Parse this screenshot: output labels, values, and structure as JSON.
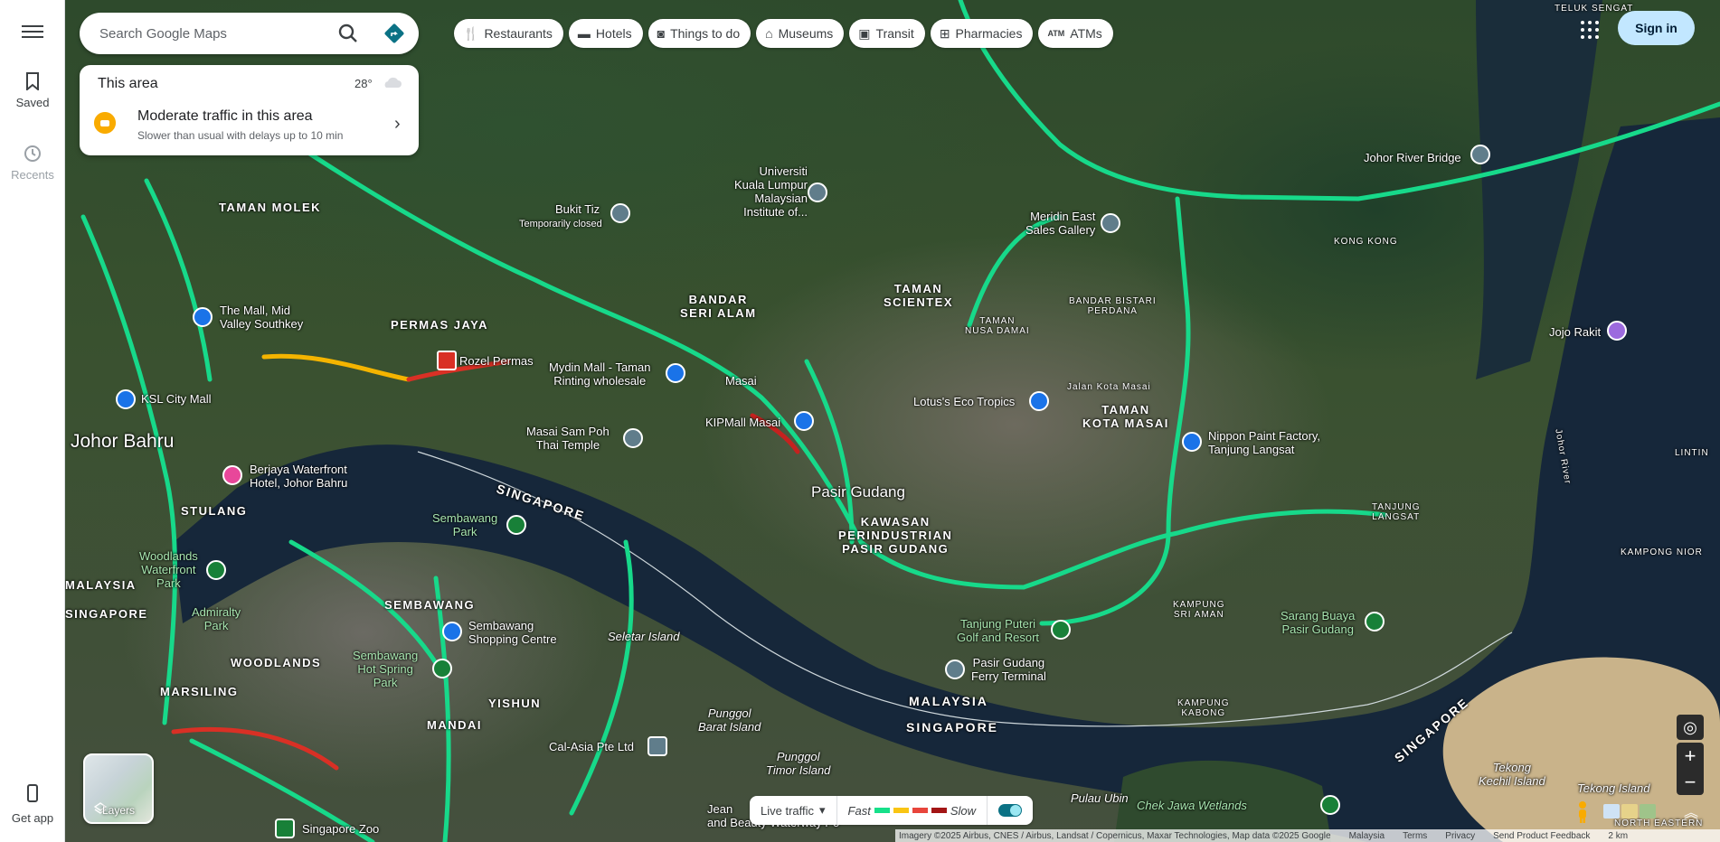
{
  "rail": {
    "saved": "Saved",
    "recents": "Recents",
    "get_app": "Get app"
  },
  "search": {
    "placeholder": "Search Google Maps"
  },
  "chips": [
    {
      "label": "Restaurants",
      "icon": "fork-knife-icon"
    },
    {
      "label": "Hotels",
      "icon": "bed-icon"
    },
    {
      "label": "Things to do",
      "icon": "camera-icon"
    },
    {
      "label": "Museums",
      "icon": "museum-icon"
    },
    {
      "label": "Transit",
      "icon": "train-icon"
    },
    {
      "label": "Pharmacies",
      "icon": "pharmacy-icon"
    },
    {
      "label": "ATMs",
      "icon": "atm-icon"
    }
  ],
  "header": {
    "sign_in": "Sign in"
  },
  "card": {
    "title": "This area",
    "temperature": "28°",
    "traffic_title": "Moderate traffic in this area",
    "traffic_detail": "Slower than usual with delays up to 10 min"
  },
  "layers": {
    "label": "Layers"
  },
  "legend": {
    "live": "Live traffic",
    "fast": "Fast",
    "slow": "Slow",
    "colors": [
      "#16e08a",
      "#f9c513",
      "#e8453c",
      "#a31515"
    ]
  },
  "footer": {
    "attribution": "Imagery ©2025 Airbus, CNES / Airbus, Landsat / Copernicus, Maxar Technologies, Map data ©2025 Google",
    "region": "Malaysia",
    "terms": "Terms",
    "privacy": "Privacy",
    "feedback": "Send Product Feedback",
    "scale": "2 km"
  },
  "map_labels": {
    "johor_bahru": "Johor Bahru",
    "taman_molek": "TAMAN MOLEK",
    "permas_jaya": "PERMAS JAYA",
    "bandar_seri_alam": "BANDAR\nSERI ALAM",
    "taman_scientex": "TAMAN\nSCIENTEX",
    "pasir_gudang": "Pasir Gudang",
    "kawasan": "KAWASAN\nPERINDUSTRIAN\nPASIR GUDANG",
    "taman_kota_masai": "TAMAN\nKOTA MASAI",
    "masai": "Masai",
    "sembawang": "SEMBAWANG",
    "woodlands": "WOODLANDS",
    "marsiling": "MARSILING",
    "yishun": "YISHUN",
    "mandai": "MANDAI",
    "stulang": "STULANG",
    "malaysia_left": "MALAYSIA",
    "singapore_left": "SINGAPORE",
    "singapore_strait": "SINGAPORE",
    "malaysia_mid": "MALAYSIA",
    "singapore_mid": "SINGAPORE",
    "singapore_right": "SINGAPORE",
    "kampong_nior": "KAMPONG NIOR",
    "kong_kong": "KONG KONG",
    "teluk_sengat": "TELUK SENGAT",
    "seletar_island": "Seletar Island",
    "punggol_barat": "Punggol\nBarat Island",
    "punggol_timor": "Punggol\nTimor Island",
    "pulau_ubin": "Pulau Ubin",
    "chek_jawa": "Chek Jawa Wetlands",
    "tekong_kechil": "Tekong\nKechil Island",
    "tekong_island": "Tekong Island",
    "north_eastern": "NORTH EASTERN",
    "johor_river_bridge": "Johor River Bridge",
    "jojo_rakit": "Jojo Rakit",
    "nippon_paint": "Nippon Paint Factory,\nTanjung Langsat",
    "meridin": "Meridin East\nSales Gallery",
    "lotus": "Lotus's Eco Tropics",
    "kipmall": "KIPMall Masai",
    "mydin": "Mydin Mall - Taman\nRinting wholesale",
    "rozel": "Rozel Permas",
    "masai_sam_poh": "Masai Sam Poh\nThai Temple",
    "bukit_tiz": "Bukit Tiz",
    "bukit_tiz_status": "Temporarily closed",
    "universiti": "Universiti\nKuala Lumpur\nMalaysian\nInstitute of...",
    "mall_mid_valley": "The Mall, Mid\nValley Southkey",
    "ksl": "KSL City Mall",
    "berjaya": "Berjaya Waterfront\nHotel, Johor Bahru",
    "sembawang_park": "Sembawang\nPark",
    "woodlands_waterfront": "Woodlands\nWaterfront\nPark",
    "admiralty": "Admiralty\nPark",
    "sembawang_shopping": "Sembawang\nShopping Centre",
    "sembawang_hot_spring": "Sembawang\nHot Spring\nPark",
    "cal_asia": "Cal-Asia Pte Ltd",
    "singapore_zoo": "Singapore Zoo",
    "tanjung_puteri": "Tanjung Puteri\nGolf and Resort",
    "pasir_gudang_ferry": "Pasir Gudang\nFerry Terminal",
    "sarang_buaya": "Sarang Buaya\nPasir Gudang",
    "kampung_kabong": "KAMPUNG\nKABONG",
    "kampung_sri_aman": "KAMPUNG\nSRI AMAN",
    "jean_and_beauty": "Jean\nand Beauty Waterway Po",
    "taman_nusa_damai": "TAMAN\nNUSA DAMAI",
    "bandar_bistari": "BANDAR BISTARI\nPERDANA",
    "jalan_kota_masai": "Jalan Kota Masai",
    "tanjung_langsat": "TANJUNG\nLANGSAT",
    "johor_river": "Johor River",
    "lintin": "LINTIN"
  }
}
